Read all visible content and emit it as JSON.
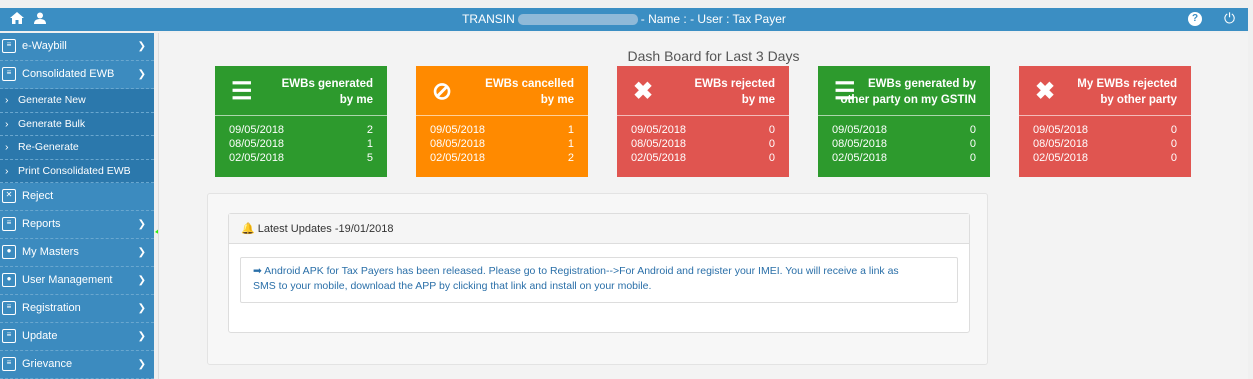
{
  "header": {
    "prefix": "TRANSIN",
    "suffix": "- Name : - User : Tax Payer"
  },
  "sidebar": {
    "items": [
      {
        "label": "e-Waybill",
        "icon": "document-icon"
      },
      {
        "label": "Consolidated EWB",
        "icon": "clipboard-icon"
      },
      {
        "label": "Generate New",
        "sub": true
      },
      {
        "label": "Generate Bulk",
        "sub": true
      },
      {
        "label": "Re-Generate",
        "sub": true
      },
      {
        "label": "Print Consolidated EWB",
        "sub": true
      },
      {
        "label": "Reject",
        "icon": "reject-icon"
      },
      {
        "label": "Reports",
        "icon": "report-icon"
      },
      {
        "label": "My Masters",
        "icon": "masters-icon"
      },
      {
        "label": "User Management",
        "icon": "users-icon"
      },
      {
        "label": "Registration",
        "icon": "registration-icon"
      },
      {
        "label": "Update",
        "icon": "update-icon"
      },
      {
        "label": "Grievance",
        "icon": "grievance-icon"
      }
    ]
  },
  "dashboard": {
    "title": "Dash Board for Last 3 Days",
    "cards": [
      {
        "label1": "EWBs generated",
        "label2": "by me",
        "color": "#2d9a2d",
        "rows": [
          [
            "09/05/2018",
            "2"
          ],
          [
            "08/05/2018",
            "1"
          ],
          [
            "02/05/2018",
            "5"
          ]
        ]
      },
      {
        "label1": "EWBs cancelled",
        "label2": "by me",
        "color": "#ff8a00",
        "rows": [
          [
            "09/05/2018",
            "1"
          ],
          [
            "08/05/2018",
            "1"
          ],
          [
            "02/05/2018",
            "2"
          ]
        ]
      },
      {
        "label1": "EWBs rejected",
        "label2": "by me",
        "color": "#e05550",
        "rows": [
          [
            "09/05/2018",
            "0"
          ],
          [
            "08/05/2018",
            "0"
          ],
          [
            "02/05/2018",
            "0"
          ]
        ]
      },
      {
        "label1": "EWBs generated by",
        "label2": "other party on my GSTIN",
        "color": "#2d9a2d",
        "rows": [
          [
            "09/05/2018",
            "0"
          ],
          [
            "08/05/2018",
            "0"
          ],
          [
            "02/05/2018",
            "0"
          ]
        ]
      },
      {
        "label1": "My EWBs rejected",
        "label2": "by other party",
        "color": "#e05550",
        "rows": [
          [
            "09/05/2018",
            "0"
          ],
          [
            "08/05/2018",
            "0"
          ],
          [
            "02/05/2018",
            "0"
          ]
        ]
      }
    ]
  },
  "updates": {
    "heading": "Latest Updates -19/01/2018",
    "line1": "Android APK for Tax Payers has been released. Please go to Registration-->For Android and register your IMEI. You will receive a link as",
    "line2": "SMS to your mobile, download the APP by clicking that link and install on your mobile."
  }
}
